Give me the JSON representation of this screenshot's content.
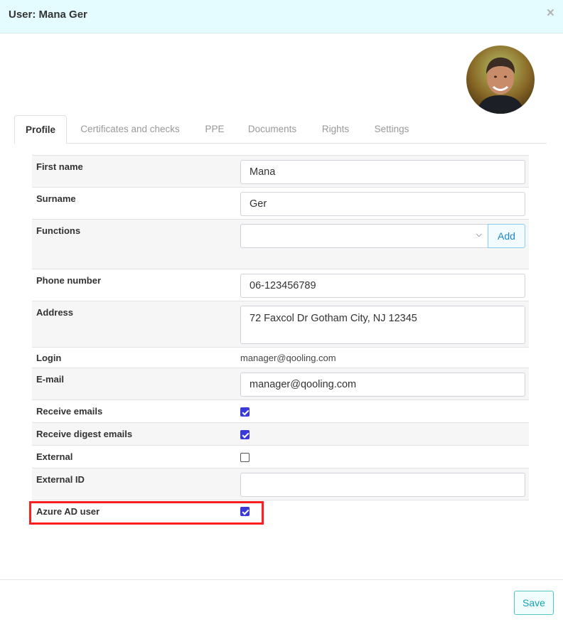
{
  "header": {
    "title": "User: Mana Ger",
    "close_glyph": "×"
  },
  "avatar": {
    "icon": "user-avatar-photo"
  },
  "tabs": [
    {
      "label": "Profile",
      "active": true
    },
    {
      "label": "Certificates and checks",
      "active": false
    },
    {
      "label": "PPE",
      "active": false
    },
    {
      "label": "Documents",
      "active": false
    },
    {
      "label": "Rights",
      "active": false
    },
    {
      "label": "Settings",
      "active": false
    }
  ],
  "form": {
    "first_name": {
      "label": "First name",
      "value": "Mana"
    },
    "surname": {
      "label": "Surname",
      "value": "Ger"
    },
    "functions": {
      "label": "Functions",
      "selected": "",
      "add_label": "Add"
    },
    "phone": {
      "label": "Phone number",
      "value": "06-123456789"
    },
    "address": {
      "label": "Address",
      "value": "72 Faxcol Dr Gotham City, NJ 12345"
    },
    "login": {
      "label": "Login",
      "value": "manager@qooling.com"
    },
    "email": {
      "label": "E-mail",
      "value": "manager@qooling.com"
    },
    "receive_emails": {
      "label": "Receive emails",
      "checked": true
    },
    "receive_digest": {
      "label": "Receive digest emails",
      "checked": true
    },
    "external": {
      "label": "External",
      "checked": false
    },
    "external_id": {
      "label": "External ID",
      "value": ""
    },
    "azure_ad": {
      "label": "Azure AD user",
      "checked": true
    }
  },
  "footer": {
    "save_label": "Save"
  },
  "colors": {
    "highlight": "#ff1d1d",
    "checkbox": "#3a3ad8",
    "header_bg": "#e4fbff"
  }
}
